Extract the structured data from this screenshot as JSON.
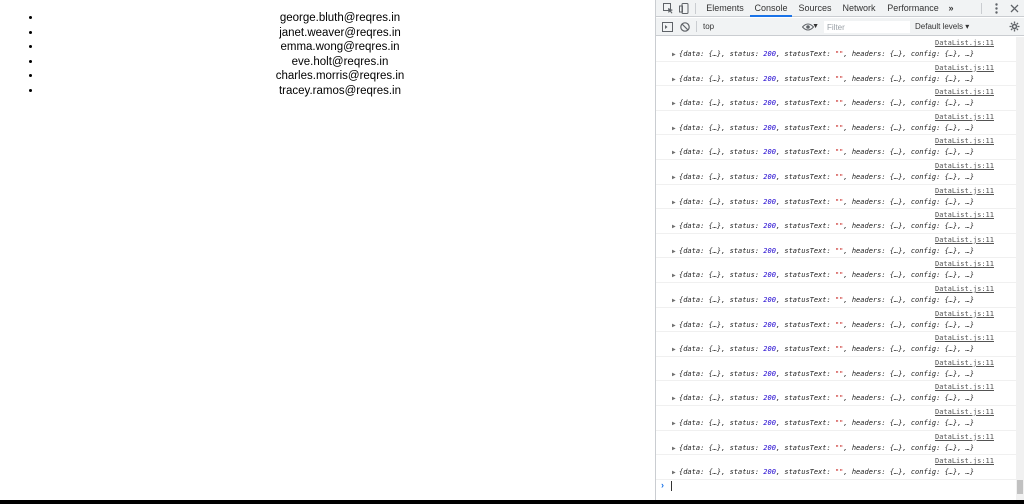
{
  "page": {
    "emails": [
      "george.bluth@reqres.in",
      "janet.weaver@reqres.in",
      "emma.wong@reqres.in",
      "eve.holt@reqres.in",
      "charles.morris@reqres.in",
      "tracey.ramos@reqres.in"
    ]
  },
  "devtools": {
    "tabs": [
      "Elements",
      "Console",
      "Sources",
      "Network",
      "Performance"
    ],
    "active_tab": "Console",
    "more_tabs_label": "»",
    "toolbar": {
      "context": "top",
      "filter_placeholder": "Filter",
      "levels": "Default levels ▾"
    },
    "log_source": "DataList.js:11",
    "log_parts": {
      "open": "{data: {…}, status: ",
      "status": "200",
      "mid": ", statusText: ",
      "status_text": "\"\"",
      "close": ", headers: {…}, config: {…}, …}"
    },
    "log_count": 18,
    "prompt": "›"
  },
  "colors": {
    "accent": "#1a73e8",
    "number": "#1c00cf",
    "string": "#c41a16"
  },
  "icons": [
    "inspect-icon",
    "device-toolbar-icon",
    "kebab-menu-icon",
    "close-icon",
    "sidebar-toggle-icon",
    "clear-console-icon",
    "eye-icon",
    "settings-gear-icon"
  ]
}
